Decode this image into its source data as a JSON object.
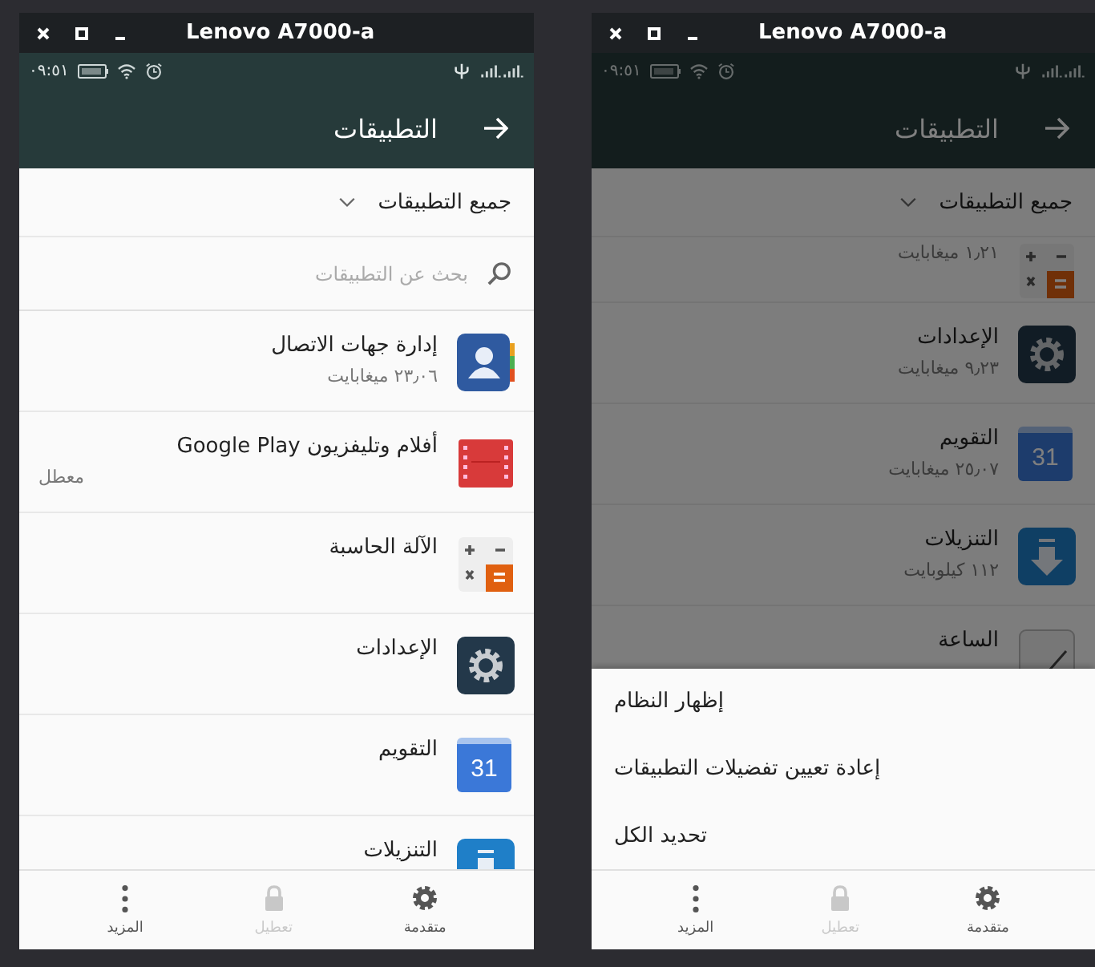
{
  "left_window": {
    "window": {
      "title": "Lenovo A7000-a"
    },
    "status_bar": {
      "time": "٠٩:٥١"
    },
    "app_bar": {
      "title": "التطبيقات"
    },
    "filter": {
      "label": "جميع التطبيقات"
    },
    "search": {
      "placeholder": "بحث عن التطبيقات"
    },
    "dimmed": false,
    "apps": [
      {
        "kind": "contacts",
        "name": "إدارة جهات الاتصال",
        "size": "٢٣٫٠٦ ميغابايت"
      },
      {
        "kind": "film",
        "name": "أفلام وتليفزيون Google Play",
        "note": "معطل"
      },
      {
        "kind": "calculator",
        "name": "الآلة الحاسبة"
      },
      {
        "kind": "settings",
        "name": "الإعدادات"
      },
      {
        "kind": "calendar",
        "icon_label": "31",
        "name": "التقويم"
      },
      {
        "kind": "download",
        "name": "التنزيلات"
      }
    ],
    "bottom_bar": [
      {
        "kind": "gear",
        "label": "متقدمة",
        "disabled": false
      },
      {
        "kind": "lock",
        "label": "تعطيل",
        "disabled": true
      },
      {
        "kind": "dots",
        "label": "المزيد",
        "disabled": false
      }
    ]
  },
  "right_window": {
    "window": {
      "title": "Lenovo A7000-a"
    },
    "status_bar": {
      "time": "٠٩:٥١"
    },
    "app_bar": {
      "title": "التطبيقات"
    },
    "filter": {
      "label": "جميع التطبيقات"
    },
    "dimmed": true,
    "apps": [
      {
        "kind": "calculator",
        "size": "١٫٢١ ميغابايت"
      },
      {
        "kind": "settings",
        "name": "الإعدادات",
        "size": "٩٫٢٣ ميغابايت"
      },
      {
        "kind": "calendar",
        "icon_label": "31",
        "name": "التقويم",
        "size": "٢٥٫٠٧ ميغابايت"
      },
      {
        "kind": "download",
        "name": "التنزيلات",
        "size": "١١٢ كيلوبايت"
      },
      {
        "kind": "clock",
        "name": "الساعة"
      }
    ],
    "menu": [
      "إظهار النظام",
      "إعادة تعيين تفضيلات التطبيقات",
      "تحديد الكل"
    ],
    "bottom_bar": [
      {
        "kind": "gear",
        "label": "متقدمة",
        "disabled": false
      },
      {
        "kind": "lock",
        "label": "تعطيل",
        "disabled": true
      },
      {
        "kind": "dots",
        "label": "المزيد",
        "disabled": false
      }
    ]
  }
}
